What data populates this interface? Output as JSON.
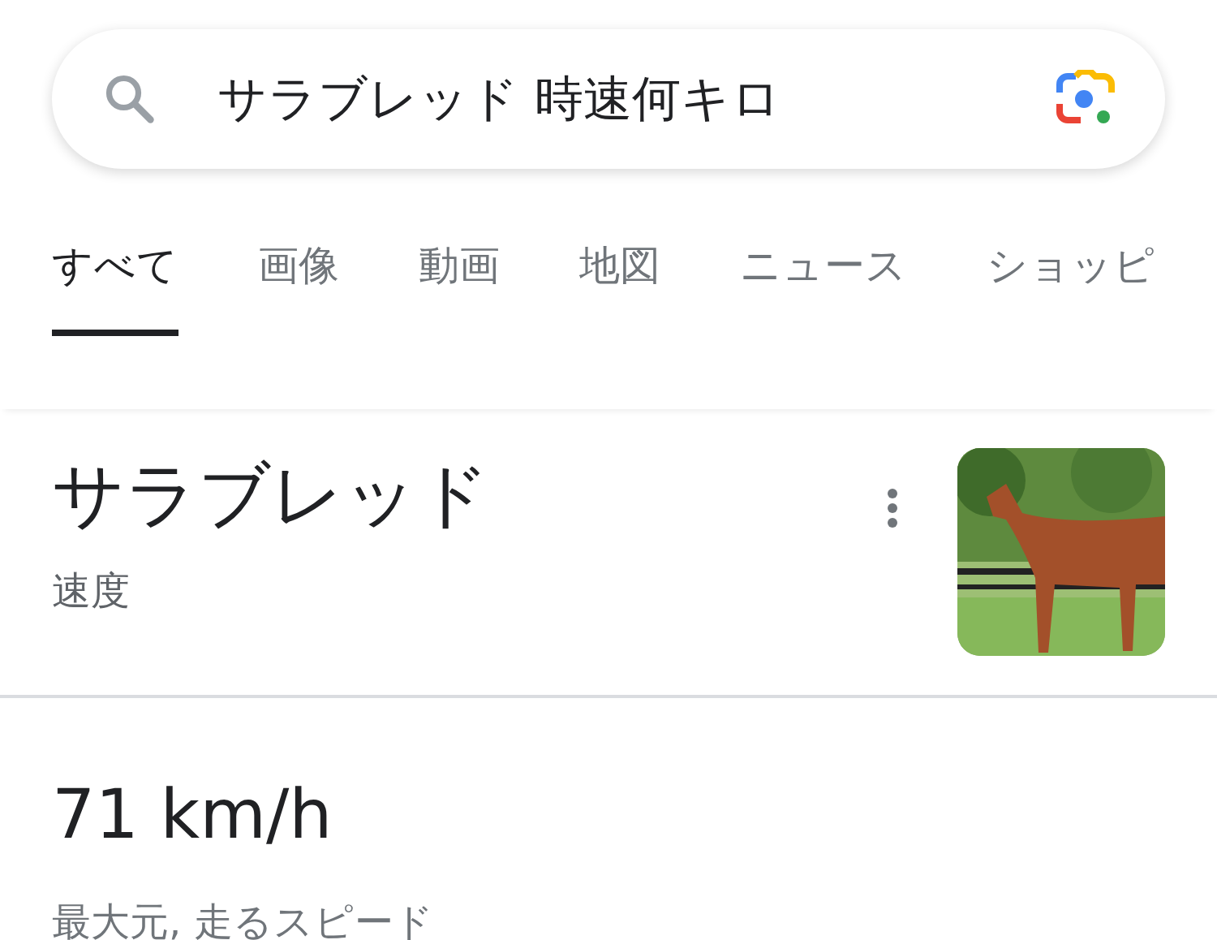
{
  "search": {
    "value": "サラブレッド 時速何キロ"
  },
  "tabs": [
    {
      "label": "すべて",
      "selected": true
    },
    {
      "label": "画像",
      "selected": false
    },
    {
      "label": "動画",
      "selected": false
    },
    {
      "label": "地図",
      "selected": false
    },
    {
      "label": "ニュース",
      "selected": false
    },
    {
      "label": "ショッピ",
      "selected": false
    }
  ],
  "entity": {
    "title": "サラブレッド",
    "subtitle": "速度"
  },
  "answer": {
    "value": "71 km/h",
    "caption": "最大元, 走るスピード"
  }
}
